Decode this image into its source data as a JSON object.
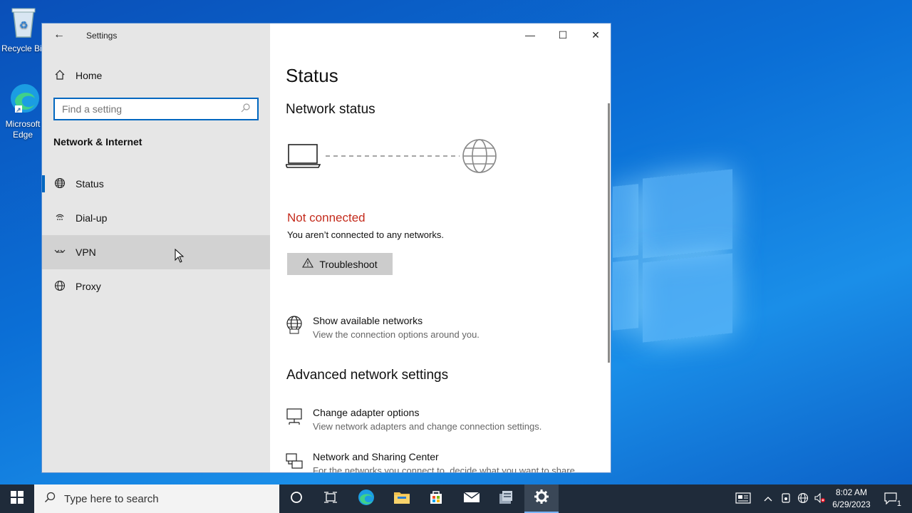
{
  "desktop": {
    "icons": [
      {
        "label": "Recycle Bin"
      },
      {
        "label": "Microsoft Edge"
      }
    ]
  },
  "window": {
    "title": "Settings",
    "controls": {
      "minimize": "—",
      "maximize": "☐",
      "close": "✕"
    }
  },
  "sidebar": {
    "home_label": "Home",
    "search_placeholder": "Find a setting",
    "section_title": "Network & Internet",
    "items": [
      {
        "label": "Status",
        "icon": "globe-icon",
        "selected": true
      },
      {
        "label": "Dial-up",
        "icon": "dialup-icon"
      },
      {
        "label": "VPN",
        "icon": "vpn-icon",
        "hovered": true
      },
      {
        "label": "Proxy",
        "icon": "globe-icon"
      }
    ]
  },
  "content": {
    "page_title": "Status",
    "network_status_heading": "Network status",
    "connection_state": "Not connected",
    "connection_state_color": "#c42b1c",
    "connection_desc": "You aren’t connected to any networks.",
    "troubleshoot_label": "Troubleshoot",
    "show_networks": {
      "title": "Show available networks",
      "subtitle": "View the connection options around you."
    },
    "advanced_heading": "Advanced network settings",
    "adapter_options": {
      "title": "Change adapter options",
      "subtitle": "View network adapters and change connection settings."
    },
    "sharing_center": {
      "title": "Network and Sharing Center",
      "subtitle": "For the networks you connect to, decide what you want to share."
    }
  },
  "taskbar": {
    "search_placeholder": "Type here to search",
    "time": "8:02 AM",
    "date": "6/29/2023",
    "notification_count": "1",
    "accent": "#7ab4ff"
  }
}
